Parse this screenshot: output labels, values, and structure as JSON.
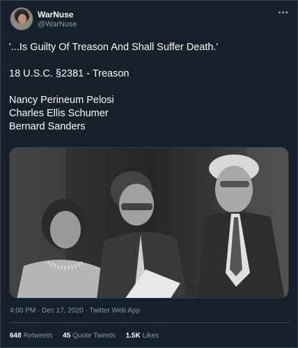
{
  "author": {
    "display_name": "WarNuse",
    "handle": "@WarNuse",
    "avatar_icon": "profile-photo"
  },
  "more_icon": "ellipsis-icon",
  "tweet": {
    "lines": [
      "'...Is Guilty Of Treason And Shall Suffer Death.'",
      "18 U.S.C. §2381 - Treason",
      "Nancy Perineum Pelosi",
      "Charles Ellis Schumer",
      "Bernard Sanders"
    ]
  },
  "meta": {
    "time": "4:00 PM",
    "separator": "·",
    "date": "Dec 17, 2020",
    "app": "Twitter Web App"
  },
  "stats": {
    "retweets_count": "648",
    "retweets_label": "Retweets",
    "quotes_count": "45",
    "quotes_label": "Quote Tweets",
    "likes_count": "1.5K",
    "likes_label": "Likes"
  },
  "colors": {
    "background": "#15202b",
    "text_primary": "#ffffff",
    "text_secondary": "#8899a6",
    "border": "#38444d"
  }
}
